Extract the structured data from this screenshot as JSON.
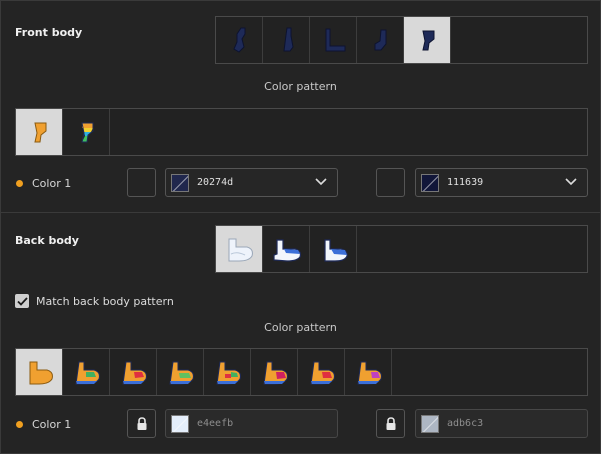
{
  "front_body": {
    "title": "Front body",
    "shapes": [
      {
        "icon": "front-body-shape-1-icon",
        "selected": false
      },
      {
        "icon": "front-body-shape-2-icon",
        "selected": false
      },
      {
        "icon": "front-body-shape-3-icon",
        "selected": false
      },
      {
        "icon": "front-body-shape-4-icon",
        "selected": false
      },
      {
        "icon": "front-body-shape-5-icon",
        "selected": true
      }
    ],
    "pattern_heading": "Color pattern",
    "patterns": [
      {
        "icon": "front-pattern-solid-icon",
        "selected": true
      },
      {
        "icon": "front-pattern-rainbow-icon",
        "selected": false
      }
    ],
    "color1_label": "Color 1",
    "color_a": {
      "hex": "20274d",
      "swatch": "#20274d"
    },
    "color_b": {
      "hex": "111639",
      "swatch": "#111639"
    }
  },
  "back_body": {
    "title": "Back body",
    "shapes": [
      {
        "icon": "back-body-shape-1-icon",
        "selected": true
      },
      {
        "icon": "back-body-shape-2-icon",
        "selected": false
      },
      {
        "icon": "back-body-shape-3-icon",
        "selected": false
      }
    ],
    "match_label": "Match back body pattern",
    "match_checked": true,
    "pattern_heading": "Color pattern",
    "patterns": [
      {
        "icon": "back-pattern-solid-icon",
        "selected": true
      },
      {
        "icon": "back-pattern-2-icon",
        "selected": false
      },
      {
        "icon": "back-pattern-3-icon",
        "selected": false
      },
      {
        "icon": "back-pattern-4-icon",
        "selected": false
      },
      {
        "icon": "back-pattern-5-icon",
        "selected": false
      },
      {
        "icon": "back-pattern-6-icon",
        "selected": false
      },
      {
        "icon": "back-pattern-7-icon",
        "selected": false
      },
      {
        "icon": "back-pattern-8-icon",
        "selected": false
      }
    ],
    "color1_label": "Color 1",
    "color_a": {
      "hex": "e4eefb",
      "swatch": "#e4eefb",
      "locked": true
    },
    "color_b": {
      "hex": "adb6c3",
      "swatch": "#adb6c3",
      "locked": true
    }
  },
  "colors": {
    "accent_dot": "#f0a020",
    "orange": "#f0a030",
    "navy": "#1e2a58"
  }
}
